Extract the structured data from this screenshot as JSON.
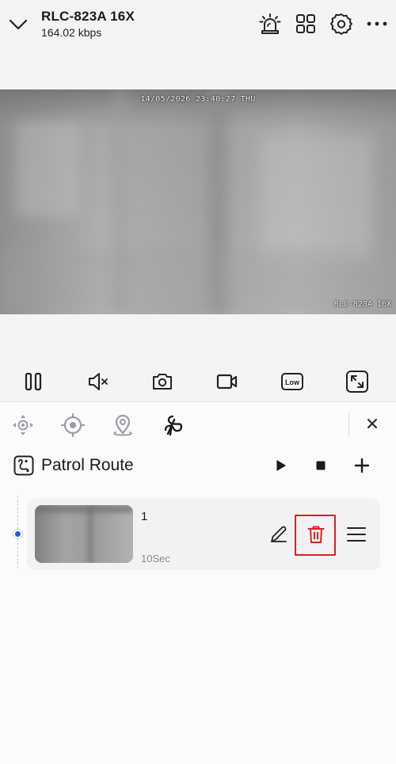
{
  "header": {
    "camera_name": "RLC-823A 16X",
    "bitrate": "164.02 kbps",
    "icons": [
      "chevron-down-icon",
      "siren-icon",
      "grid-view-icon",
      "gear-icon",
      "more-icon"
    ]
  },
  "video": {
    "osd_timestamp": "14/05/2026 23:40:27 THU",
    "osd_camera_name": "RLC-823A 16X"
  },
  "toolbar": {
    "buttons": [
      "pause-icon",
      "mute-icon",
      "snapshot-icon",
      "record-icon",
      "quality-icon",
      "fullscreen-icon"
    ],
    "quality_label": "Low"
  },
  "ptz_tabs": [
    "ptz-move-icon",
    "preset-target-icon",
    "location-pin-icon",
    "patrol-route-icon"
  ],
  "patrol": {
    "title": "Patrol Route",
    "actions": [
      "play-icon",
      "stop-icon",
      "add-icon"
    ],
    "presets": [
      {
        "name": "1",
        "duration": "10Sec"
      }
    ]
  },
  "colors": {
    "accent": "#1e5be5",
    "delete_red": "#e02020",
    "highlight_border": "#e02020"
  }
}
